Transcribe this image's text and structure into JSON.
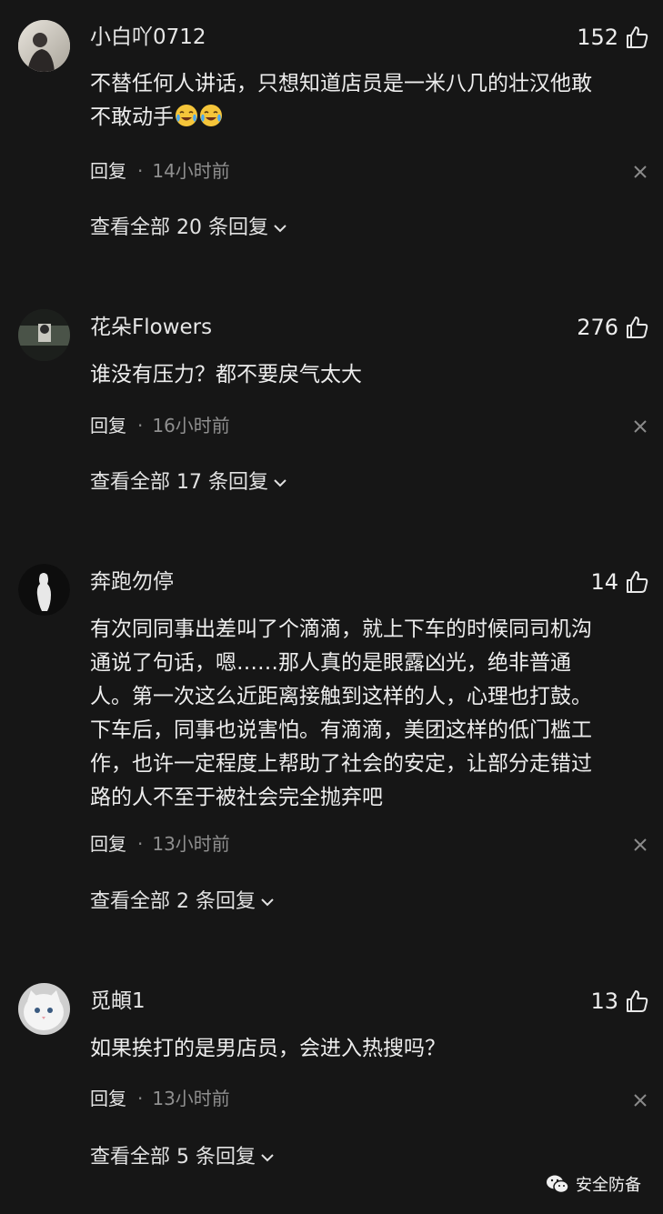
{
  "comments": [
    {
      "username": "小白吖0712",
      "likes": "152",
      "lines": [
        "不替任何人讲话，只想知道店员是一米八几的壮汉他敢",
        "不敢动手"
      ],
      "emoji_count": 2,
      "reply_label": "回复",
      "separator": "·",
      "time": "14小时前",
      "view_all": "查看全部 20 条回复"
    },
    {
      "username": "花朵Flowers",
      "likes": "276",
      "lines": [
        "谁没有压力？都不要戾气太大"
      ],
      "reply_label": "回复",
      "separator": "·",
      "time": "16小时前",
      "view_all": "查看全部 17 条回复"
    },
    {
      "username": "奔跑勿停",
      "likes": "14",
      "lines": [
        "有次同同事出差叫了个滴滴，就上下车的时候同司机沟",
        "通说了句话，嗯……那人真的是眼露凶光，绝非普通",
        "人。第一次这么近距离接触到这样的人，心理也打鼓。",
        "下车后，同事也说害怕。有滴滴，美团这样的低门槛工",
        "作，也许一定程度上帮助了社会的安定，让部分走错过",
        "路的人不至于被社会完全抛弃吧"
      ],
      "reply_label": "回复",
      "separator": "·",
      "time": "13小时前",
      "view_all": "查看全部 2 条回复"
    },
    {
      "username": "觅頔1",
      "likes": "13",
      "lines": [
        "如果挨打的是男店员，会进入热搜吗？"
      ],
      "reply_label": "回复",
      "separator": "·",
      "time": "13小时前",
      "view_all": "查看全部 5 条回复"
    }
  ],
  "watermark": {
    "icon": "wechat-icon",
    "text": "安全防备"
  },
  "icons": {
    "like": "thumbs-up-icon",
    "close": "close-icon",
    "expand": "chevron-down-icon",
    "emoji": "crying-laughing-emoji"
  },
  "colors": {
    "background": "#161616",
    "text": "#ededed",
    "muted": "#8f8f8f"
  }
}
